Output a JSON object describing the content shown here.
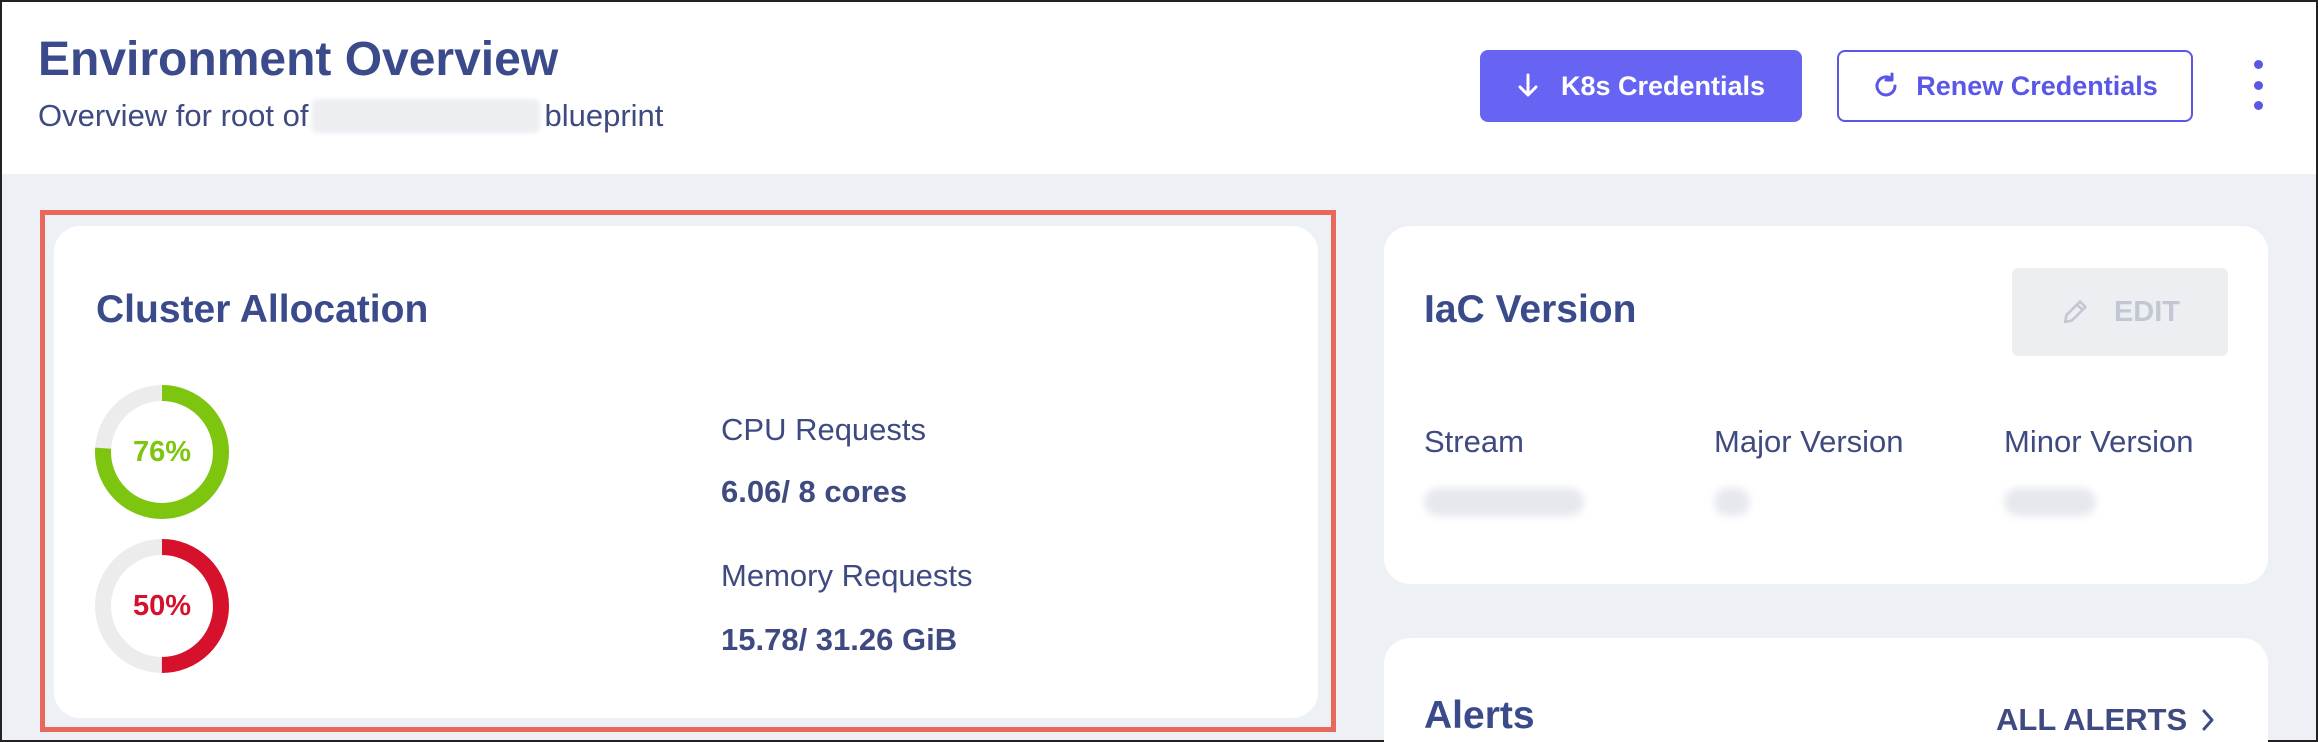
{
  "header": {
    "title": "Environment Overview",
    "subtitle_prefix": "Overview for root of",
    "subtitle_suffix": "blueprint",
    "k8s_button": "K8s Credentials",
    "renew_button": "Renew Credentials"
  },
  "cluster": {
    "title": "Cluster Allocation",
    "cpu": {
      "percent_label": "76%",
      "fraction": 0.76,
      "color": "#7dc50f",
      "label": "CPU Requests",
      "value": "6.06/ 8 cores"
    },
    "memory": {
      "percent_label": "50%",
      "fraction": 0.5,
      "color": "#d6112c",
      "label": "Memory Requests",
      "value": "15.78/ 31.26 GiB"
    }
  },
  "iac": {
    "title": "IaC Version",
    "edit_label": "EDIT",
    "columns": [
      "Stream",
      "Major Version",
      "Minor Version"
    ]
  },
  "alerts": {
    "title": "Alerts",
    "all_label": "ALL ALERTS"
  },
  "colors": {
    "accent": "#6764f4",
    "title": "#3a4a8a",
    "highlight": "#e8685c",
    "background": "#edf0f5"
  },
  "icons": [
    "download-arrow-icon",
    "refresh-icon",
    "kebab-menu-icon",
    "pencil-icon",
    "chevron-right-icon"
  ]
}
